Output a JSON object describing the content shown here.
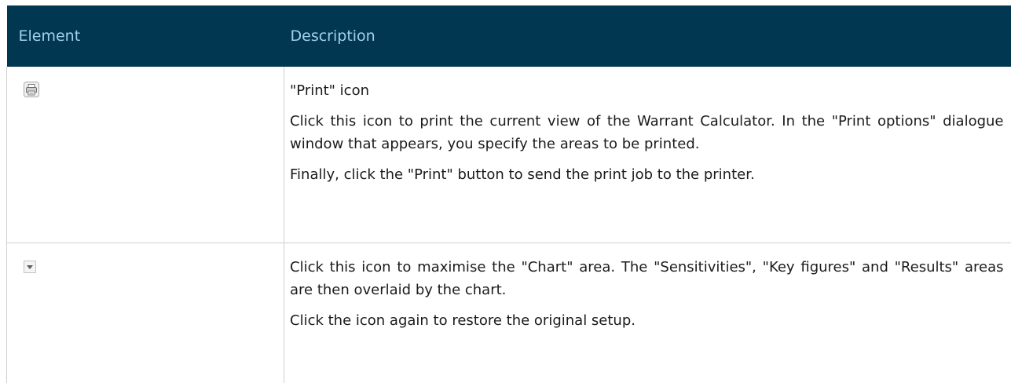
{
  "table": {
    "headers": {
      "element": "Element",
      "description": "Description"
    },
    "rows": [
      {
        "icon": "print-icon",
        "paragraphs": [
          "\"Print\" icon",
          "Click this icon to print the current view of the Warrant Calculator. In the \"Print options\" dialogue window that appears, you specify the areas to be printed.",
          "Finally, click the \"Print\" button to send the print job to the printer."
        ]
      },
      {
        "icon": "chevron-down-icon",
        "paragraphs": [
          "Click this icon to maximise the \"Chart\" area. The \"Sensitivities\", \"Key figures\" and \"Results\" areas are then overlaid by the chart.",
          "Click the icon again to restore the original setup."
        ]
      }
    ]
  },
  "colors": {
    "header_bg": "#013750",
    "header_text": "#9fd1ea",
    "border": "#cfcfcf",
    "body_text": "#1b1b1b"
  }
}
